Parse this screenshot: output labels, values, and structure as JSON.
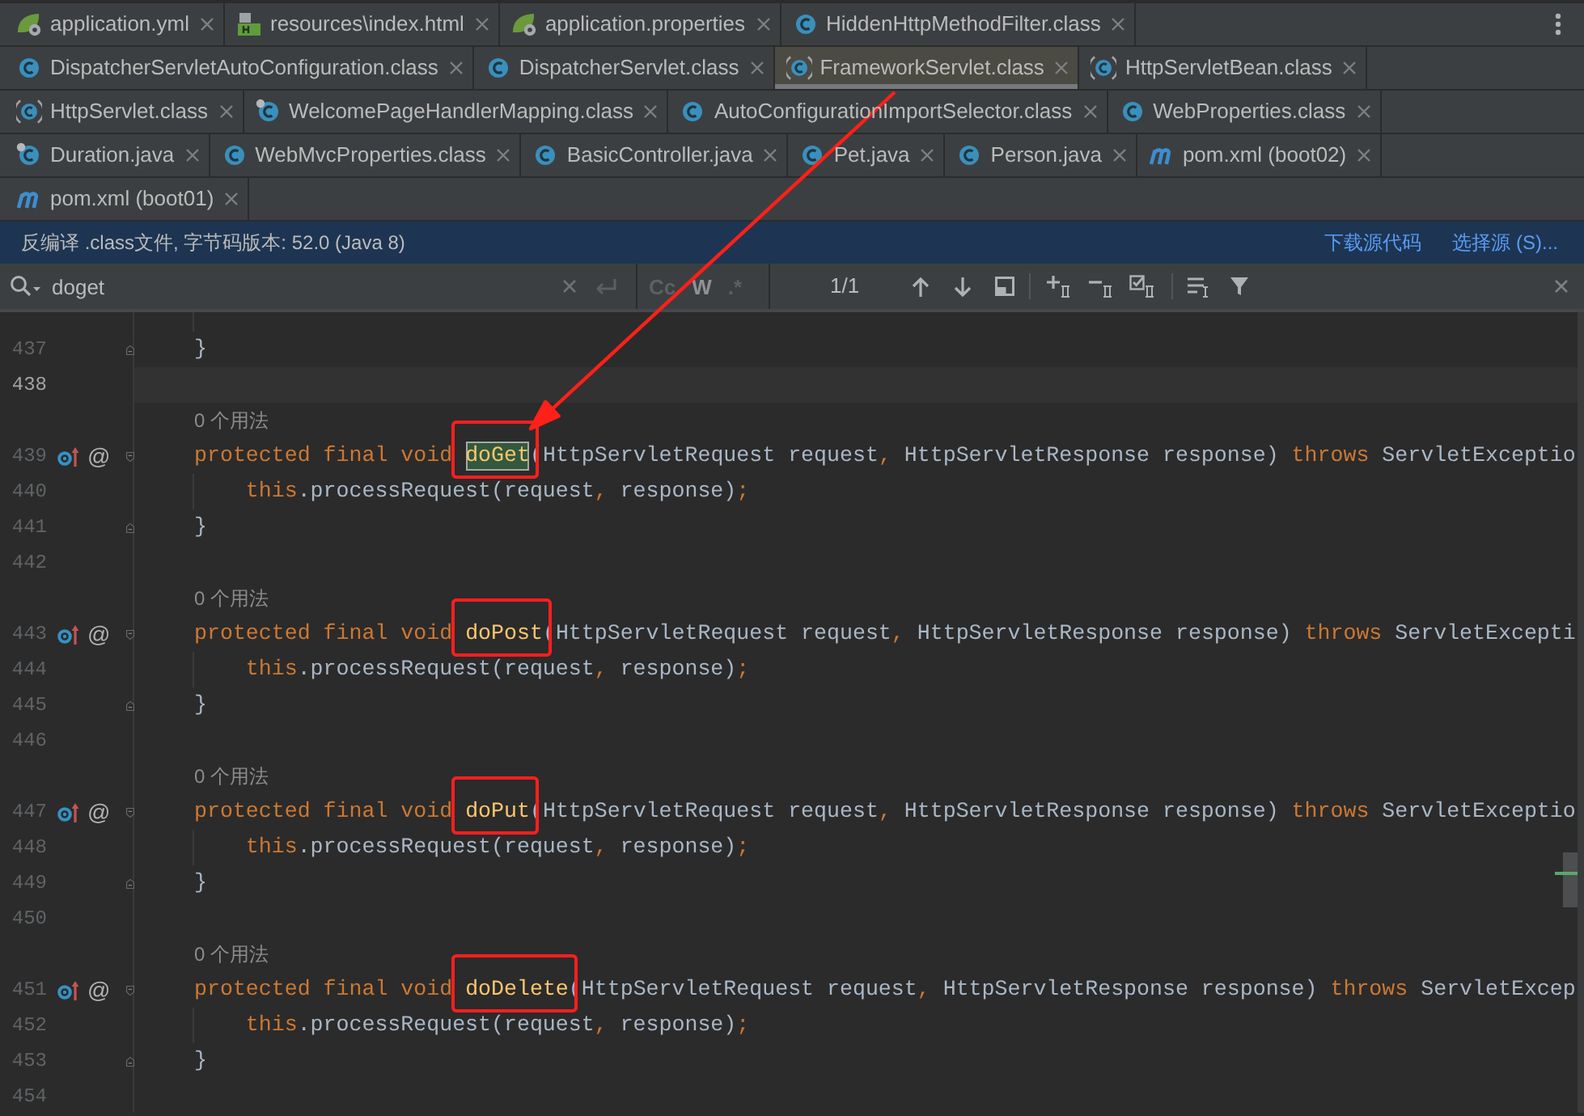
{
  "tab_rows": [
    [
      {
        "label": "application.yml",
        "kind": "spring",
        "selected": false
      },
      {
        "label": "resources\\index.html",
        "kind": "html",
        "selected": false
      },
      {
        "label": "application.properties",
        "kind": "spring",
        "selected": false
      },
      {
        "label": "HiddenHttpMethodFilter.class",
        "kind": "class",
        "selected": false
      }
    ],
    [
      {
        "label": "DispatcherServletAutoConfiguration.class",
        "kind": "class",
        "selected": false
      },
      {
        "label": "DispatcherServlet.class",
        "kind": "class",
        "selected": false
      },
      {
        "label": "FrameworkServlet.class",
        "kind": "abstract",
        "selected": true
      },
      {
        "label": "HttpServletBean.class",
        "kind": "abstract",
        "selected": false
      }
    ],
    [
      {
        "label": "HttpServlet.class",
        "kind": "abstract",
        "selected": false
      },
      {
        "label": "WelcomePageHandlerMapping.class",
        "kind": "pinned",
        "selected": false
      },
      {
        "label": "AutoConfigurationImportSelector.class",
        "kind": "class",
        "selected": false
      },
      {
        "label": "WebProperties.class",
        "kind": "class",
        "selected": false
      }
    ],
    [
      {
        "label": "Duration.java",
        "kind": "pinned",
        "selected": false
      },
      {
        "label": "WebMvcProperties.class",
        "kind": "class",
        "selected": false
      },
      {
        "label": "BasicController.java",
        "kind": "class",
        "selected": false
      },
      {
        "label": "Pet.java",
        "kind": "class",
        "selected": false
      },
      {
        "label": "Person.java",
        "kind": "class",
        "selected": false
      },
      {
        "label": "pom.xml (boot02)",
        "kind": "maven",
        "selected": false
      }
    ],
    [
      {
        "label": "pom.xml (boot01)",
        "kind": "maven",
        "selected": false
      }
    ]
  ],
  "notice_bar": {
    "text": "反编译 .class文件, 字节码版本: 52.0 (Java 8)",
    "links": [
      "下载源代码",
      "选择源 (S)..."
    ]
  },
  "find_bar": {
    "query": "doget",
    "toggles": [
      {
        "label": "Cc",
        "disabled": true
      },
      {
        "label": "W",
        "disabled": false
      },
      {
        "label": ".*",
        "disabled": true
      }
    ],
    "match_count": "1/1"
  },
  "editor": {
    "lines": [
      {
        "kind": "blank",
        "indented": true
      },
      {
        "kind": "closer",
        "number": "437",
        "current": false,
        "tokens": [
          {
            "text": "}",
            "kind": "plain"
          }
        ]
      },
      {
        "kind": "blank",
        "number": "438",
        "current": true
      },
      {
        "kind": "hint",
        "text": "0 个用法"
      },
      {
        "kind": "opener",
        "number": "439",
        "current": false,
        "override": true,
        "gutter_mark": "@",
        "tokens": [
          {
            "text": "protected final void ",
            "kind": "keyword"
          },
          {
            "text": "doGet",
            "kind": "method",
            "match": true,
            "outlined": true
          },
          {
            "text": "(HttpServletRequest request",
            "kind": "plain"
          },
          {
            "text": ", ",
            "kind": "punct"
          },
          {
            "text": "HttpServletResponse response) ",
            "kind": "plain"
          },
          {
            "text": "throws",
            "kind": "keyword"
          },
          {
            "text": " ServletExceptio",
            "kind": "plain"
          }
        ]
      },
      {
        "kind": "body",
        "number": "440",
        "current": false,
        "indented": true,
        "tokens": [
          {
            "text": "this",
            "kind": "keyword"
          },
          {
            "text": ".processRequest(request",
            "kind": "plain"
          },
          {
            "text": ", ",
            "kind": "punct"
          },
          {
            "text": "response)",
            "kind": "plain"
          },
          {
            "text": ";",
            "kind": "punct"
          }
        ]
      },
      {
        "kind": "closer",
        "number": "441",
        "current": false,
        "tokens": [
          {
            "text": "}",
            "kind": "plain"
          }
        ]
      },
      {
        "kind": "blank",
        "number": "442",
        "current": false
      },
      {
        "kind": "hint",
        "text": "0 个用法"
      },
      {
        "kind": "opener",
        "number": "443",
        "current": false,
        "override": true,
        "gutter_mark": "@",
        "tokens": [
          {
            "text": "protected final void ",
            "kind": "keyword"
          },
          {
            "text": "doPost",
            "kind": "method",
            "match": false,
            "outlined": true
          },
          {
            "text": "(HttpServletRequest request",
            "kind": "plain"
          },
          {
            "text": ", ",
            "kind": "punct"
          },
          {
            "text": "HttpServletResponse response) ",
            "kind": "plain"
          },
          {
            "text": "throws",
            "kind": "keyword"
          },
          {
            "text": " ServletExcepti",
            "kind": "plain"
          }
        ]
      },
      {
        "kind": "body",
        "number": "444",
        "current": false,
        "indented": true,
        "tokens": [
          {
            "text": "this",
            "kind": "keyword"
          },
          {
            "text": ".processRequest(request",
            "kind": "plain"
          },
          {
            "text": ", ",
            "kind": "punct"
          },
          {
            "text": "response)",
            "kind": "plain"
          },
          {
            "text": ";",
            "kind": "punct"
          }
        ]
      },
      {
        "kind": "closer",
        "number": "445",
        "current": false,
        "tokens": [
          {
            "text": "}",
            "kind": "plain"
          }
        ]
      },
      {
        "kind": "blank",
        "number": "446",
        "current": false
      },
      {
        "kind": "hint",
        "text": "0 个用法"
      },
      {
        "kind": "opener",
        "number": "447",
        "current": false,
        "override": true,
        "gutter_mark": "@",
        "tokens": [
          {
            "text": "protected final void ",
            "kind": "keyword"
          },
          {
            "text": "doPut",
            "kind": "method",
            "match": false,
            "outlined": true
          },
          {
            "text": "(HttpServletRequest request",
            "kind": "plain"
          },
          {
            "text": ", ",
            "kind": "punct"
          },
          {
            "text": "HttpServletResponse response) ",
            "kind": "plain"
          },
          {
            "text": "throws",
            "kind": "keyword"
          },
          {
            "text": " ServletExceptio",
            "kind": "plain"
          }
        ]
      },
      {
        "kind": "body",
        "number": "448",
        "current": false,
        "indented": true,
        "tokens": [
          {
            "text": "this",
            "kind": "keyword"
          },
          {
            "text": ".processRequest(request",
            "kind": "plain"
          },
          {
            "text": ", ",
            "kind": "punct"
          },
          {
            "text": "response)",
            "kind": "plain"
          },
          {
            "text": ";",
            "kind": "punct"
          }
        ]
      },
      {
        "kind": "closer",
        "number": "449",
        "current": false,
        "tokens": [
          {
            "text": "}",
            "kind": "plain"
          }
        ]
      },
      {
        "kind": "blank",
        "number": "450",
        "current": false
      },
      {
        "kind": "hint",
        "text": "0 个用法"
      },
      {
        "kind": "opener",
        "number": "451",
        "current": false,
        "override": true,
        "gutter_mark": "@",
        "tokens": [
          {
            "text": "protected final void ",
            "kind": "keyword"
          },
          {
            "text": "doDelete",
            "kind": "method",
            "match": false,
            "outlined": true
          },
          {
            "text": "(HttpServletRequest request",
            "kind": "plain"
          },
          {
            "text": ", ",
            "kind": "punct"
          },
          {
            "text": "HttpServletResponse response) ",
            "kind": "plain"
          },
          {
            "text": "throws",
            "kind": "keyword"
          },
          {
            "text": " ServletExcep",
            "kind": "plain"
          }
        ]
      },
      {
        "kind": "body",
        "number": "452",
        "current": false,
        "indented": true,
        "tokens": [
          {
            "text": "this",
            "kind": "keyword"
          },
          {
            "text": ".processRequest(request",
            "kind": "plain"
          },
          {
            "text": ", ",
            "kind": "punct"
          },
          {
            "text": "response)",
            "kind": "plain"
          },
          {
            "text": ";",
            "kind": "punct"
          }
        ]
      },
      {
        "kind": "closer",
        "number": "453",
        "current": false,
        "tokens": [
          {
            "text": "}",
            "kind": "plain"
          }
        ]
      },
      {
        "kind": "blank",
        "number": "454",
        "current": false
      }
    ]
  },
  "annotation_arrow": true
}
